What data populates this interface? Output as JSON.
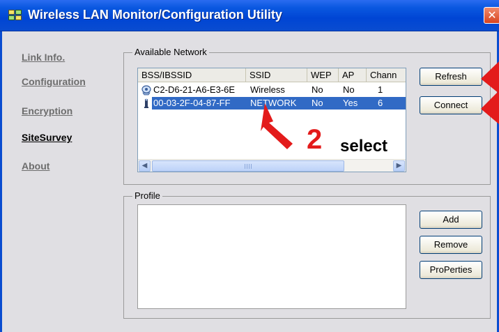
{
  "window": {
    "title": "Wireless LAN Monitor/Configuration Utility",
    "close_glyph": "✕"
  },
  "nav": {
    "items": [
      {
        "label": "Link Info.",
        "active": false
      },
      {
        "label": "Configuration",
        "active": false
      },
      {
        "label": "Encryption",
        "active": false
      },
      {
        "label": "SiteSurvey",
        "active": true
      },
      {
        "label": "About",
        "active": false
      }
    ]
  },
  "available_network": {
    "legend": "Available Network",
    "columns": [
      "BSS/IBSSID",
      "SSID",
      "WEP",
      "AP",
      "Chann"
    ],
    "rows": [
      {
        "icon": "network-adapter-icon",
        "bssid": "C2-D6-21-A6-E3-6E",
        "ssid": "Wireless",
        "wep": "No",
        "ap": "No",
        "channel": "1",
        "selected": false
      },
      {
        "icon": "access-point-icon",
        "bssid": "00-03-2F-04-87-FF",
        "ssid": "NETWORK",
        "wep": "No",
        "ap": "Yes",
        "channel": "6",
        "selected": true
      }
    ],
    "refresh_label": "Refresh",
    "connect_label": "Connect",
    "scroll_left_glyph": "◀",
    "scroll_right_glyph": "▶"
  },
  "profile": {
    "legend": "Profile",
    "add_label": "Add",
    "remove_label": "Remove",
    "properties_label": "ProPerties"
  },
  "annotation": {
    "step_number": "2",
    "step_text": "select",
    "color": "#e31b1b"
  },
  "colors": {
    "titlebar": "#0a58e0",
    "selection": "#316ac5",
    "panel": "#e0dfe3"
  }
}
